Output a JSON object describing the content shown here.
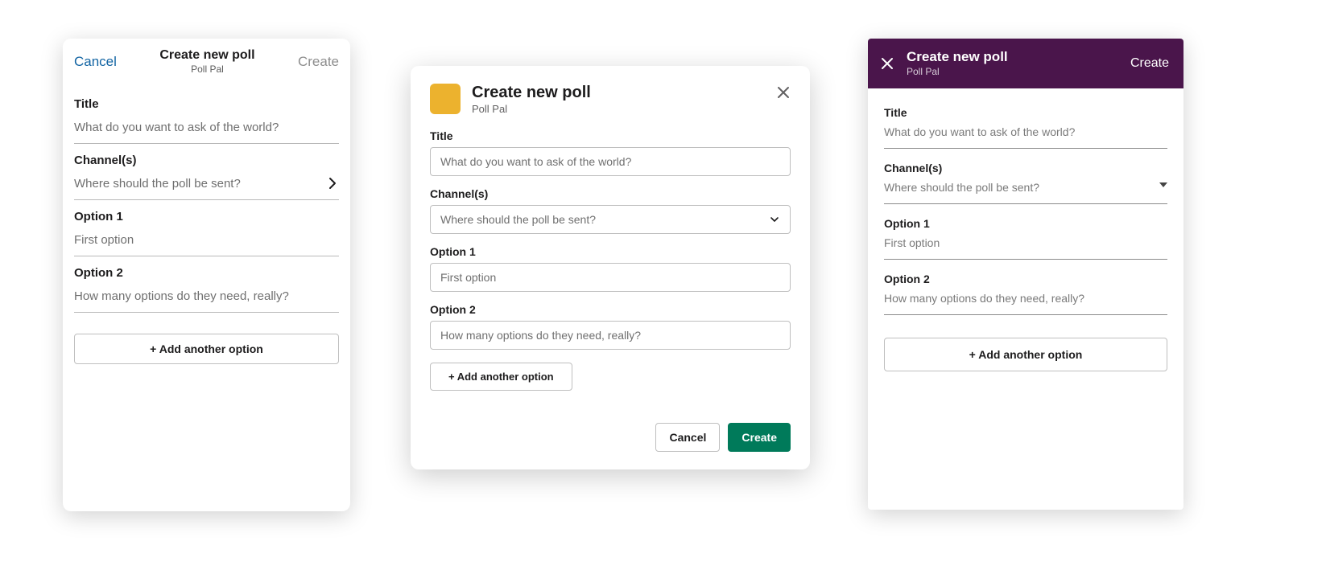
{
  "common": {
    "modal_title": "Create new poll",
    "app_name": "Poll Pal",
    "title_label": "Title",
    "title_placeholder": "What do you want to ask of the world?",
    "channels_label": "Channel(s)",
    "channels_placeholder": "Where should the poll be sent?",
    "option1_label": "Option 1",
    "option1_placeholder": "First option",
    "option2_label": "Option 2",
    "option2_placeholder": "How many options do they need, really?",
    "add_option_label": "+ Add another option",
    "cancel_label": "Cancel",
    "create_label": "Create"
  },
  "desktop": {
    "app_icon_color": "#ecb22e",
    "primary_button_color": "#007a5a"
  },
  "android": {
    "header_color": "#4a154b"
  }
}
